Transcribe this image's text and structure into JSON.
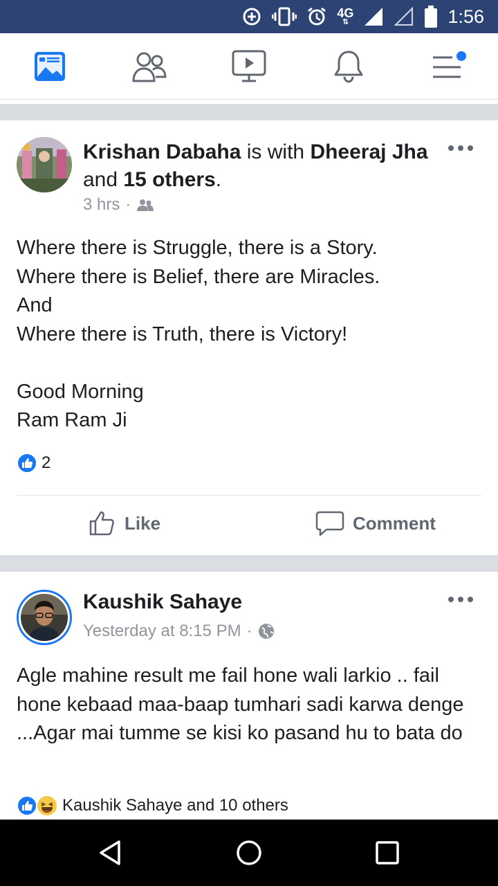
{
  "status_bar": {
    "time": "1:56",
    "network": "4G",
    "icons": [
      "data-saver-icon",
      "vibrate-icon",
      "alarm-icon",
      "signal-icon",
      "signal-empty-icon",
      "battery-icon"
    ]
  },
  "nav": {
    "items": [
      {
        "name": "news-feed",
        "icon": "news-feed-icon",
        "active": true
      },
      {
        "name": "friends",
        "icon": "friends-icon",
        "active": false
      },
      {
        "name": "watch",
        "icon": "watch-icon",
        "active": false
      },
      {
        "name": "notifications",
        "icon": "bell-icon",
        "active": false
      },
      {
        "name": "menu",
        "icon": "menu-icon",
        "active": false,
        "badge": true
      }
    ],
    "accent_color": "#1877f2"
  },
  "posts": [
    {
      "author": "Krishan Dabaha",
      "with_text": " is with ",
      "tagged": "Dheeraj Jha",
      "and_text": " and ",
      "others": "15 others",
      "period": ".",
      "time": "3 hrs",
      "audience_icon": "friends-icon",
      "text": "Where there is Struggle,  there is a Story.\nWhere there is Belief, there are Miracles.\nAnd\nWhere there is Truth, there is Victory!\n\nGood Morning\nRam Ram Ji",
      "reaction_count": "2",
      "actions": {
        "like": "Like",
        "comment": "Comment"
      }
    },
    {
      "author": "Kaushik Sahaye",
      "time": "Yesterday at 8:15 PM",
      "audience_icon": "globe-icon",
      "text": "Agle mahine result me fail hone wali larkio .. fail hone kebaad maa-baap tumhari sadi karwa denge ...Agar mai tumme se kisi ko pasand hu to bata do",
      "reaction_summary": "Kaushik Sahaye and 10 others"
    }
  ],
  "android_nav": [
    "back-icon",
    "home-icon",
    "recents-icon"
  ]
}
